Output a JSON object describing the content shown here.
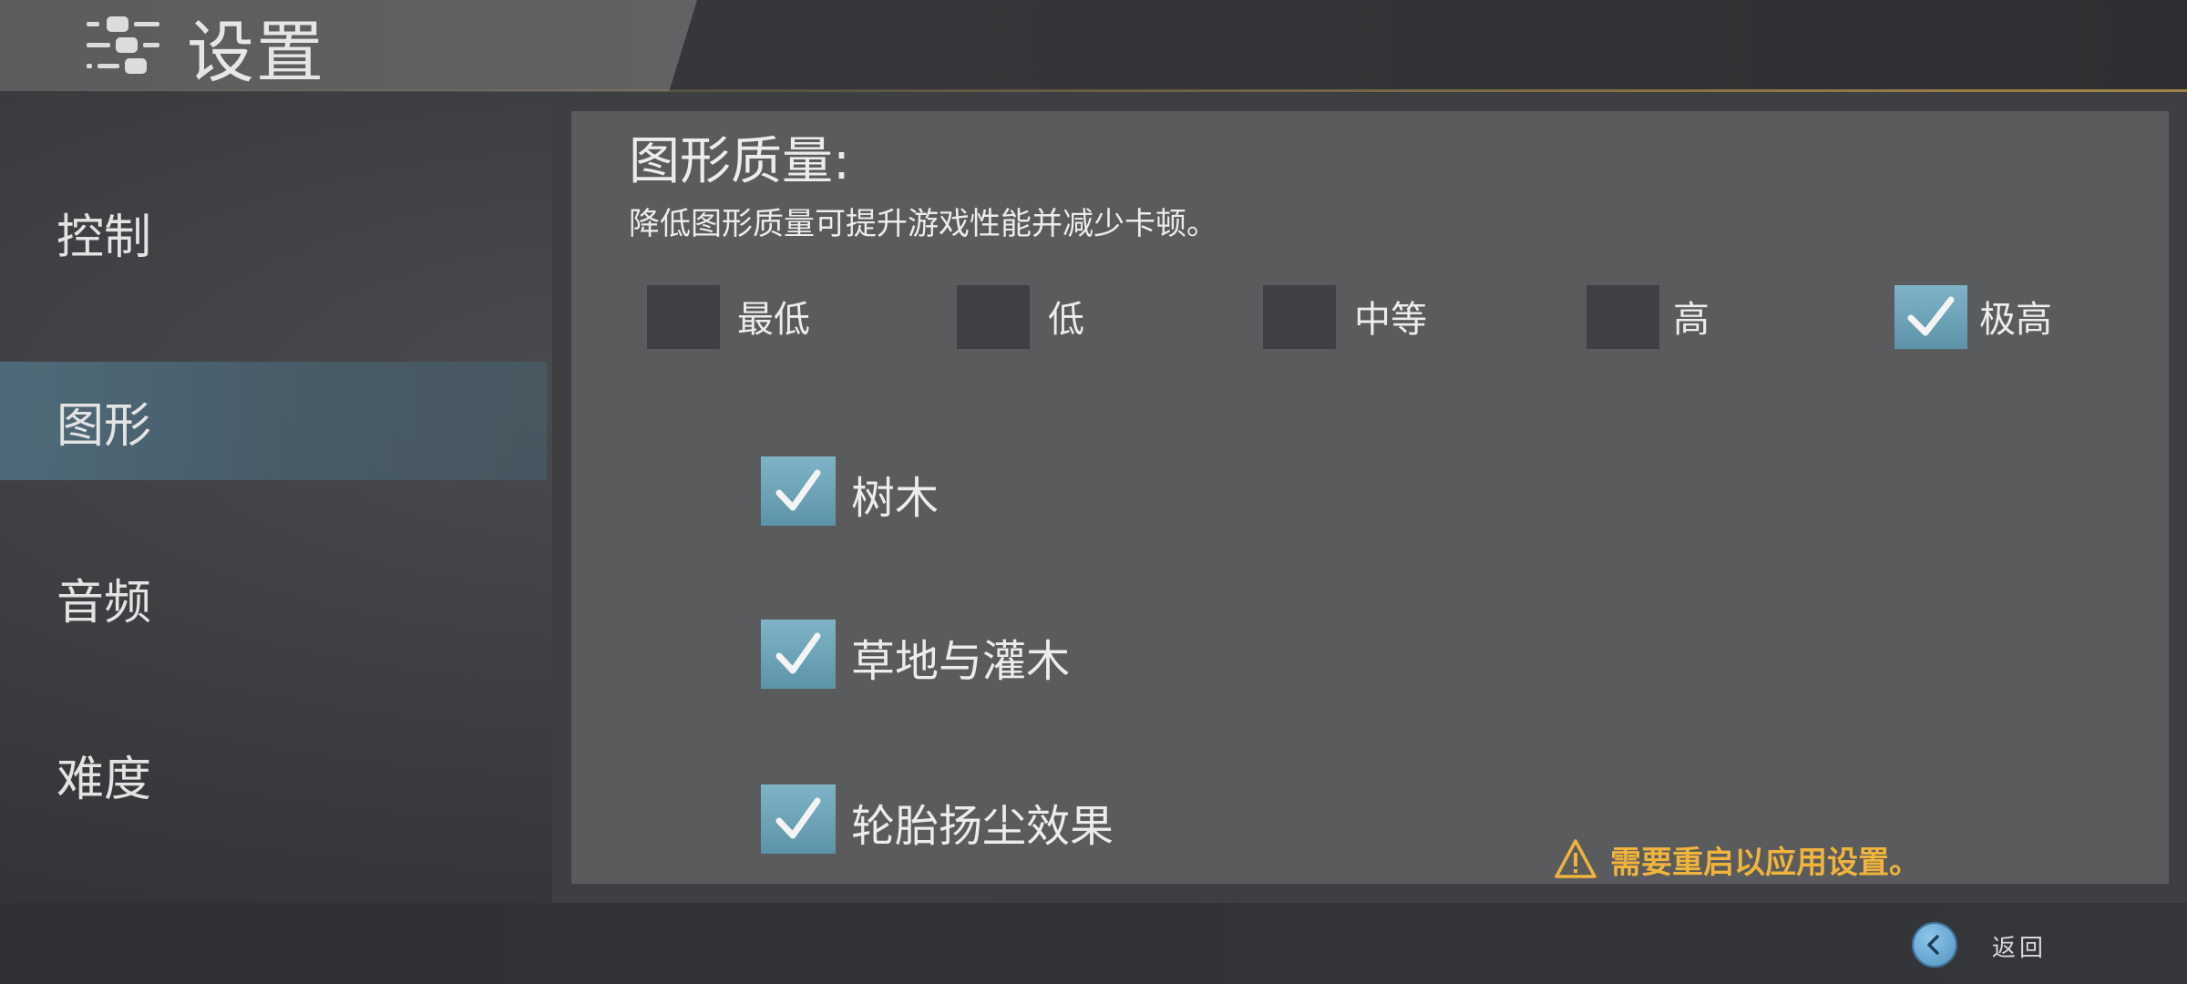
{
  "header": {
    "title": "设置",
    "icon": "sliders-icon"
  },
  "sidebar": {
    "items": [
      {
        "label": "控制",
        "active": false
      },
      {
        "label": "图形",
        "active": true
      },
      {
        "label": "音频",
        "active": false
      },
      {
        "label": "难度",
        "active": false
      }
    ]
  },
  "graphics": {
    "title": "图形质量:",
    "description": "降低图形质量可提升游戏性能并减少卡顿。",
    "quality_options": [
      {
        "label": "最低",
        "checked": false
      },
      {
        "label": "低",
        "checked": false
      },
      {
        "label": "中等",
        "checked": false
      },
      {
        "label": "高",
        "checked": false
      },
      {
        "label": "极高",
        "checked": true
      }
    ],
    "toggles": [
      {
        "label": "树木",
        "checked": true
      },
      {
        "label": "草地与灌木",
        "checked": true
      },
      {
        "label": "轮胎扬尘效果",
        "checked": true
      }
    ],
    "warning": "需要重启以应用设置。"
  },
  "footer": {
    "back_label": "返回"
  },
  "colors": {
    "accent": "#6fa6bb",
    "warning": "#f0b43c",
    "panel": "#5a5b5d"
  }
}
